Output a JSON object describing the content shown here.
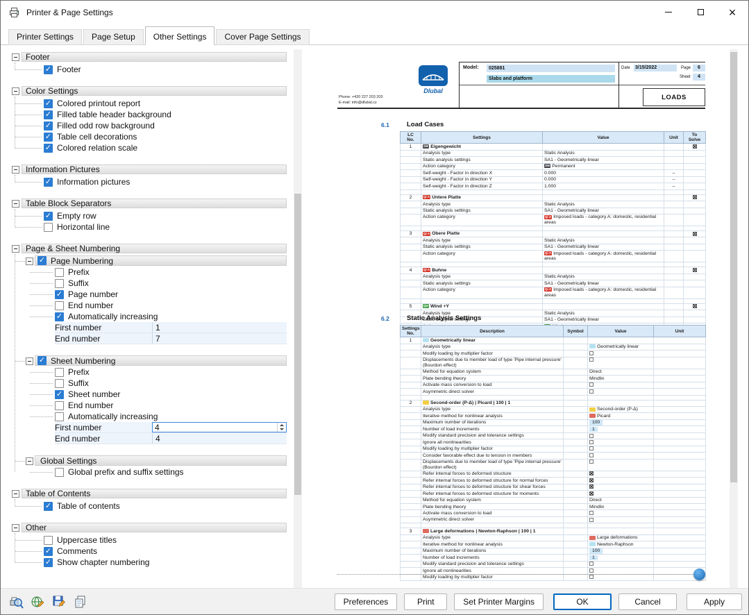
{
  "window": {
    "title": "Printer & Page Settings"
  },
  "tabs": [
    {
      "label": "Printer Settings"
    },
    {
      "label": "Page Setup"
    },
    {
      "label": "Other Settings"
    },
    {
      "label": "Cover Page Settings"
    }
  ],
  "active_tab": "Other Settings",
  "colors": {
    "accent_blue": "#2b7cd3",
    "section_number_blue": "#1a66ad",
    "table_header_blue": "#d9e9f8",
    "logo_blue": "#1261ad",
    "badge_permanent": "#44474c",
    "badge_imposed_red": "#d6362b",
    "badge_wind_green": "#43a047",
    "chip_cyan": "#b5e2f2",
    "chip_yellow": "#f3cf45",
    "chip_red": "#e06a5f"
  },
  "tree": {
    "groups": [
      {
        "title": "Footer",
        "items": [
          {
            "t": "check",
            "label": "Footer",
            "checked": true
          }
        ]
      },
      {
        "title": "Color Settings",
        "items": [
          {
            "t": "check",
            "label": "Colored printout report",
            "checked": true
          },
          {
            "t": "check",
            "label": "Filled table header background",
            "checked": true
          },
          {
            "t": "check",
            "label": "Filled odd row background",
            "checked": true
          },
          {
            "t": "check",
            "label": "Table cell decorations",
            "checked": true
          },
          {
            "t": "check",
            "label": "Colored relation scale",
            "checked": true
          }
        ]
      },
      {
        "title": "Information Pictures",
        "items": [
          {
            "t": "check",
            "label": "Information pictures",
            "checked": true
          }
        ]
      },
      {
        "title": "Table Block Separators",
        "items": [
          {
            "t": "check",
            "label": "Empty row",
            "checked": true
          },
          {
            "t": "check",
            "label": "Horizontal line",
            "checked": false
          }
        ]
      },
      {
        "title": "Page & Sheet Numbering",
        "items": [
          {
            "t": "subgroup",
            "label": "Page Numbering",
            "checked": true
          },
          {
            "t": "check",
            "label": "Prefix",
            "checked": false,
            "ind": 1
          },
          {
            "t": "check",
            "label": "Suffix",
            "checked": false,
            "ind": 1
          },
          {
            "t": "check",
            "label": "Page number",
            "checked": true,
            "ind": 1
          },
          {
            "t": "check",
            "label": "End number",
            "checked": false,
            "ind": 1
          },
          {
            "t": "check",
            "label": "Automatically increasing",
            "checked": true,
            "ind": 1
          },
          {
            "t": "value",
            "label": "First number",
            "value": "1",
            "ind": 1
          },
          {
            "t": "value",
            "label": "End number",
            "value": "7",
            "ind": 1
          },
          {
            "t": "gap"
          },
          {
            "t": "subgroup",
            "label": "Sheet Numbering",
            "checked": true
          },
          {
            "t": "check",
            "label": "Prefix",
            "checked": false,
            "ind": 1
          },
          {
            "t": "check",
            "label": "Suffix",
            "checked": false,
            "ind": 1
          },
          {
            "t": "check",
            "label": "Sheet number",
            "checked": true,
            "ind": 1
          },
          {
            "t": "check",
            "label": "End number",
            "checked": false,
            "ind": 1
          },
          {
            "t": "check",
            "label": "Automatically increasing",
            "checked": false,
            "ind": 1
          },
          {
            "t": "spin",
            "label": "First number",
            "value": "4",
            "ind": 1
          },
          {
            "t": "value",
            "label": "End number",
            "value": "4",
            "ind": 1
          },
          {
            "t": "gap"
          },
          {
            "t": "subheader",
            "label": "Global Settings"
          },
          {
            "t": "check",
            "label": "Global prefix and suffix settings",
            "checked": false,
            "ind": 1
          }
        ]
      },
      {
        "title": "Table of Contents",
        "items": [
          {
            "t": "check",
            "label": "Table of contents",
            "checked": true
          }
        ]
      },
      {
        "title": "Other",
        "items": [
          {
            "t": "check",
            "label": "Uppercase titles",
            "checked": false
          },
          {
            "t": "check",
            "label": "Comments",
            "checked": true
          },
          {
            "t": "check",
            "label": "Show chapter numbering",
            "checked": true
          }
        ]
      }
    ]
  },
  "preview": {
    "header": {
      "model_label": "Model:",
      "model_value": "025881",
      "model_name": "Slabs and platform",
      "date_label": "Date",
      "date_value": "3/15/2022",
      "page_label": "Page",
      "page_value": "6",
      "sheet_label": "Sheet",
      "sheet_value": "4",
      "chapter_title": "LOADS",
      "phone": "Phone: +420 227 203 203",
      "email": "E-mail: info@dlubal.cz",
      "logo_text": "Dlubal"
    },
    "load_cases": {
      "number": "6.1",
      "title": "Load Cases",
      "columns": [
        "LC\nNo.",
        "Settings",
        "Value",
        "Unit",
        "To\nSolve"
      ],
      "cases": [
        {
          "no": "1",
          "badge": "SW",
          "badge_color": "#44474c",
          "name": "Eigengewicht",
          "to_solve": true,
          "rows": [
            {
              "label": "Analysis type",
              "value": "Static Analysis"
            },
            {
              "label": "Static analysis settings",
              "value": "SA1 - Geometrically linear"
            },
            {
              "label": "Action category",
              "value": "Permanent",
              "value_badge": "SW",
              "value_badge_color": "#44474c"
            },
            {
              "label": "Self-weight - Factor in direction X",
              "value": "0.000",
              "unit": "–"
            },
            {
              "label": "Self-weight - Factor in direction Y",
              "value": "0.000",
              "unit": "–"
            },
            {
              "label": "Self-weight - Factor in direction Z",
              "value": "1.000",
              "unit": "–"
            }
          ]
        },
        {
          "no": "2",
          "badge": "Qi A",
          "badge_color": "#d6362b",
          "name": "Untere Platte",
          "to_solve": true,
          "rows": [
            {
              "label": "Analysis type",
              "value": "Static Analysis"
            },
            {
              "label": "Static analysis settings",
              "value": "SA1 - Geometrically linear"
            },
            {
              "label": "Action category",
              "value": "Imposed loads - category A: domestic, residential areas",
              "value_badge": "Qi A",
              "value_badge_color": "#d6362b"
            }
          ]
        },
        {
          "no": "3",
          "badge": "Qi A",
          "badge_color": "#d6362b",
          "name": "Obere Platte",
          "to_solve": true,
          "rows": [
            {
              "label": "Analysis type",
              "value": "Static Analysis"
            },
            {
              "label": "Static analysis settings",
              "value": "SA1 - Geometrically linear"
            },
            {
              "label": "Action category",
              "value": "Imposed loads - category A: domestic, residential areas",
              "value_badge": "Qi A",
              "value_badge_color": "#d6362b"
            }
          ]
        },
        {
          "no": "4",
          "badge": "Qi A",
          "badge_color": "#d6362b",
          "name": "Buhne",
          "to_solve": true,
          "rows": [
            {
              "label": "Analysis type",
              "value": "Static Analysis"
            },
            {
              "label": "Static analysis settings",
              "value": "SA1 - Geometrically linear"
            },
            {
              "label": "Action category",
              "value": "Imposed loads - category A: domestic, residential areas",
              "value_badge": "Qi A",
              "value_badge_color": "#d6362b"
            }
          ]
        },
        {
          "no": "5",
          "badge": "Qw",
          "badge_color": "#43a047",
          "name": "Wind +Y",
          "to_solve": true,
          "rows": [
            {
              "label": "Analysis type",
              "value": "Static Analysis"
            },
            {
              "label": "Static analysis settings",
              "value": "SA1 - Geometrically linear"
            },
            {
              "label": "Action category",
              "value": "Wind",
              "value_badge": "Qw",
              "value_badge_color": "#43a047"
            }
          ]
        }
      ]
    },
    "static_analysis": {
      "number": "6.2",
      "title": "Static Analysis Settings",
      "columns": [
        "Settings\nNo.",
        "Description",
        "Symbol",
        "Value",
        "Unit"
      ],
      "entries": [
        {
          "no": "1",
          "chip_color": "#b5e2f2",
          "title": "Geometrically linear",
          "rows": [
            {
              "d": "Analysis type",
              "chip": "#b5e2f2",
              "v": "Geometrically linear"
            },
            {
              "d": "Modify loading by multiplier factor",
              "cb": "empty"
            },
            {
              "d": "Displacements due to member load of type 'Pipe internal pressure' (Bourdon effect)",
              "cb": "empty"
            },
            {
              "d": "Method for equation system",
              "v": "Direct"
            },
            {
              "d": "Plate bending theory",
              "v": "Mindlin"
            },
            {
              "d": "Activate mass conversion to load",
              "cb": "empty"
            },
            {
              "d": "Asymmetric direct solver",
              "cb": "empty"
            }
          ]
        },
        {
          "no": "2",
          "chip_color": "#f3cf45",
          "title": "Second-order (P-Δ) | Picard | 100 | 1",
          "rows": [
            {
              "d": "Analysis type",
              "chip": "#f3cf45",
              "v": "Second-order (P-Δ)"
            },
            {
              "d": "Iterative method for nonlinear analysis",
              "chip": "#e06a5f",
              "v": "Picard"
            },
            {
              "d": "Maximum number of iterations",
              "v": "100",
              "num": true
            },
            {
              "d": "Number of load increments",
              "v": "1",
              "num": true
            },
            {
              "d": "Modify standard precision and tolerance settings",
              "cb": "empty"
            },
            {
              "d": "Ignore all nonlinearities",
              "cb": "empty"
            },
            {
              "d": "Modify loading by multiplier factor",
              "cb": "empty"
            },
            {
              "d": "Consider favorable effect due to tension in members",
              "cb": "empty"
            },
            {
              "d": "Displacements due to member load of type 'Pipe internal pressure' (Bourdon effect)",
              "cb": "empty"
            },
            {
              "d": "Refer internal forces to deformed structure",
              "cb": "checked"
            },
            {
              "d": "Refer internal forces to deformed structure for normal forces",
              "cb": "checked"
            },
            {
              "d": "Refer internal forces to deformed structure for shear forces",
              "cb": "checked"
            },
            {
              "d": "Refer internal forces to deformed structure for moments",
              "cb": "checked"
            },
            {
              "d": "Method for equation system",
              "v": "Direct"
            },
            {
              "d": "Plate bending theory",
              "v": "Mindlin"
            },
            {
              "d": "Activate mass conversion to load",
              "cb": "empty"
            },
            {
              "d": "Asymmetric direct solver",
              "cb": "empty"
            }
          ]
        },
        {
          "no": "3",
          "chip_color": "#e06a5f",
          "title": "Large deformations | Newton-Raphson | 100 | 1",
          "rows": [
            {
              "d": "Analysis type",
              "chip": "#e06a5f",
              "v": "Large deformations"
            },
            {
              "d": "Iterative method for nonlinear analysis",
              "chip": "#b5e2f2",
              "v": "Newton-Raphson"
            },
            {
              "d": "Maximum number of iterations",
              "v": "100",
              "num": true
            },
            {
              "d": "Number of load increments",
              "v": "1",
              "num": true
            },
            {
              "d": "Modify standard precision and tolerance settings",
              "cb": "empty"
            },
            {
              "d": "Ignore all nonlinearities",
              "cb": "empty"
            },
            {
              "d": "Modify loading by multiplier factor",
              "cb": "empty"
            }
          ]
        }
      ]
    }
  },
  "footer": {
    "tool_icons": [
      "zoom-printer-icon",
      "globe-edit-icon",
      "save-edit-icon",
      "copy-pages-icon"
    ],
    "buttons": [
      {
        "label": "Preferences"
      },
      {
        "label": "Print"
      },
      {
        "label": "Set Printer Margins"
      },
      {
        "label": "OK",
        "default": true
      },
      {
        "label": "Cancel"
      },
      {
        "label": "Apply"
      }
    ]
  }
}
